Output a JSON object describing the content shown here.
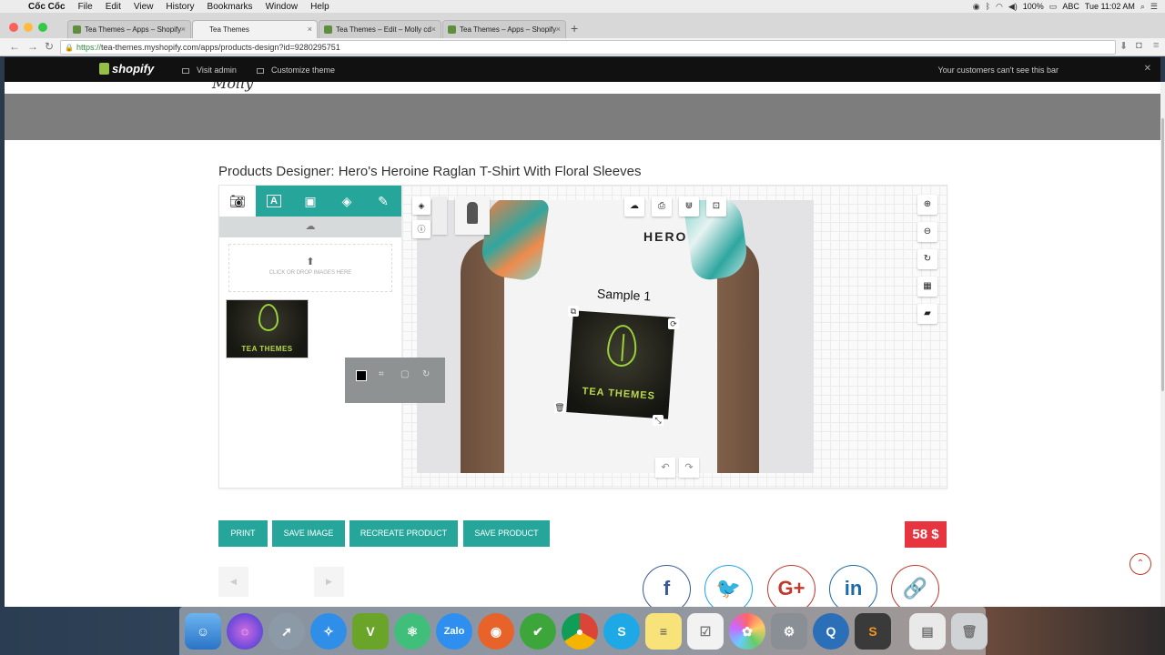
{
  "menubar": {
    "app_name": "Cốc Cốc",
    "items": [
      "File",
      "Edit",
      "View",
      "History",
      "Bookmarks",
      "Window",
      "Help"
    ],
    "battery": "100%",
    "input_source": "ABC",
    "clock": "Tue 11:02 AM"
  },
  "browser": {
    "tabs": [
      {
        "label": "Tea Themes – Apps – Shopify",
        "active": false
      },
      {
        "label": "Tea Themes",
        "active": true
      },
      {
        "label": "Tea Themes – Edit – Molly cd",
        "active": false
      },
      {
        "label": "Tea Themes – Apps – Shopify",
        "active": false
      }
    ],
    "url_scheme": "https://",
    "url_rest": "tea-themes.myshopify.com/apps/products-design?id=9280295751"
  },
  "shopify_bar": {
    "logo": "shopify",
    "visit_admin": "Visit admin",
    "customize_theme": "Customize theme",
    "notice": "Your customers can't see this bar"
  },
  "page": {
    "title": "Products Designer: Hero's Heroine Raglan T-Shirt With Floral Sleeves"
  },
  "designer": {
    "dropzone_text": "CLICK OR DROP IMAGES HERE",
    "thumbnail_text": "TEA THEMES",
    "shirt_brand": "HERO",
    "sample_text": "Sample 1",
    "design_text": "TEA THEMES"
  },
  "actions": {
    "print": "PRINT",
    "save_image": "SAVE IMAGE",
    "recreate_product": "RECREATE PRODUCT",
    "save_product": "SAVE PRODUCT",
    "price": "58 $"
  },
  "social": {
    "facebook": "f",
    "twitter": "🐦",
    "google_plus": "G+",
    "linkedin": "in",
    "link": "🔗"
  },
  "colors": {
    "accent": "#26a69a",
    "price_badge": "#e6353f",
    "facebook": "#3b5998",
    "twitter": "#1da1f2",
    "google_plus": "#c0392b",
    "linkedin": "#1c6aa6",
    "link": "#c0392b"
  }
}
